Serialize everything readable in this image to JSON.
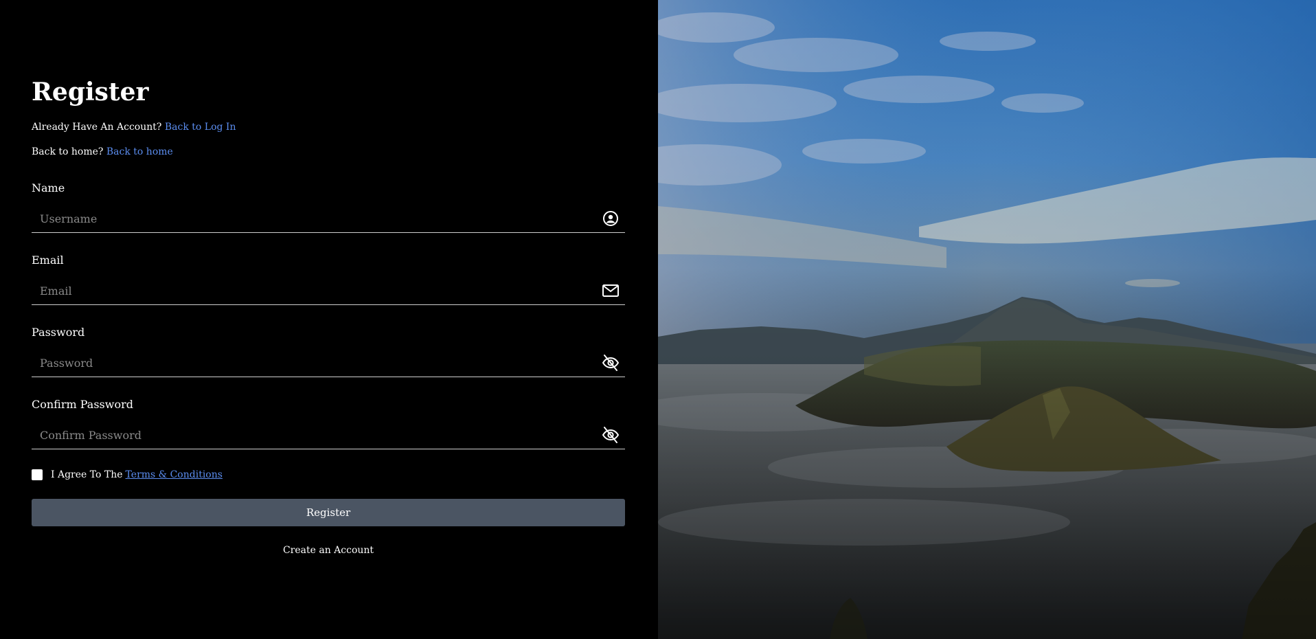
{
  "page": {
    "title": "Register"
  },
  "login_prompt": {
    "text": "Already Have An Account? ",
    "link": "Back to Log In"
  },
  "home_prompt": {
    "text": "Back to home? ",
    "link": "Back to home"
  },
  "fields": {
    "name": {
      "label": "Name",
      "placeholder": "Username",
      "value": "",
      "icon": "user-circle-icon"
    },
    "email": {
      "label": "Email",
      "placeholder": "Email",
      "value": "",
      "icon": "envelope-icon"
    },
    "password": {
      "label": "Password",
      "placeholder": "Password",
      "value": "",
      "icon": "eye-slash-icon"
    },
    "confirm_password": {
      "label": "Confirm Password",
      "placeholder": "Confirm Password",
      "value": "",
      "icon": "eye-slash-icon"
    }
  },
  "agreement": {
    "checked": false,
    "text": "I Agree To The",
    "link": "Terms & Conditions"
  },
  "register_button": {
    "label": "Register"
  },
  "create_account": {
    "label": "Create an Account"
  },
  "colors": {
    "background": "#000000",
    "link": "#5b8def",
    "button": "#4b5563"
  }
}
